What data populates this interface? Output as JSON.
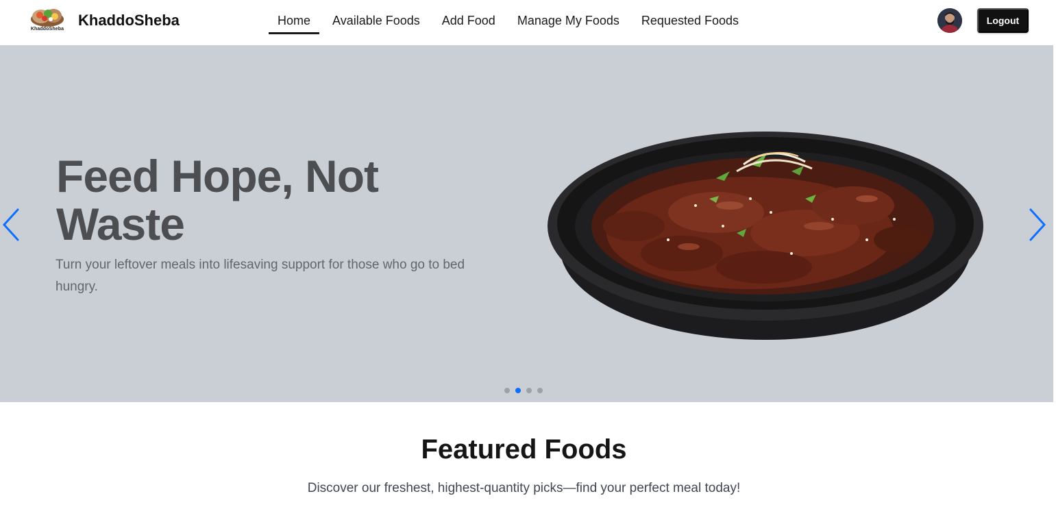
{
  "brand": {
    "name": "KhaddoSheba",
    "logo_text": "KhaddoSheba",
    "logo_icon": "food-bowl-logo"
  },
  "nav": {
    "items": [
      {
        "label": "Home",
        "active": true
      },
      {
        "label": "Available Foods",
        "active": false
      },
      {
        "label": "Add Food",
        "active": false
      },
      {
        "label": "Manage My Foods",
        "active": false
      },
      {
        "label": "Requested Foods",
        "active": false
      }
    ]
  },
  "user": {
    "avatar_icon": "user-avatar",
    "logout_label": "Logout"
  },
  "hero": {
    "title": "Feed Hope, Not Waste",
    "subtitle": "Turn your leftover meals into lifesaving support for those who go to bed hungry.",
    "slide_count": 4,
    "active_slide": 2,
    "background": "#cacfd6",
    "accent": "#0d6efd",
    "prev_icon": "chevron-left-icon",
    "next_icon": "chevron-right-icon"
  },
  "featured": {
    "title": "Featured Foods",
    "subtitle": "Discover our freshest, highest-quantity picks—find your perfect meal today!"
  }
}
